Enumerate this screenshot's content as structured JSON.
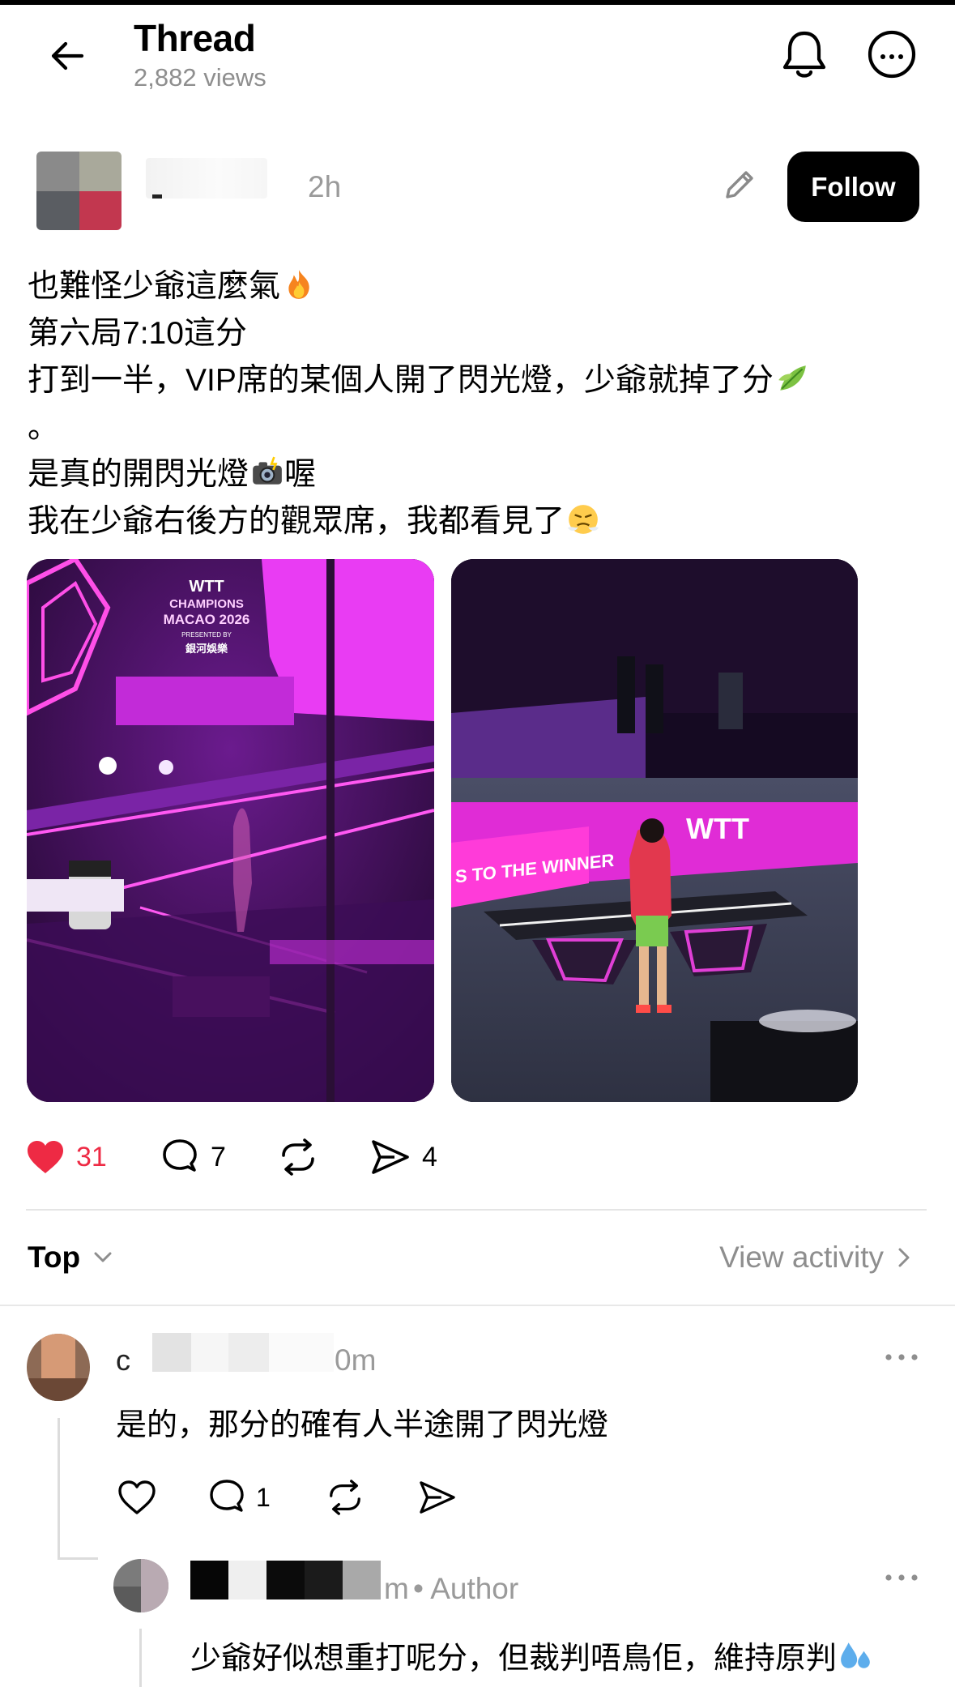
{
  "header": {
    "title": "Thread",
    "views": "2,882 views"
  },
  "post": {
    "time": "2h",
    "follow_label": "Follow",
    "lines": [
      "也難怪少爺這麼氣",
      "第六局7:10這分",
      "打到一半，VIP席的某個人開了閃光燈，少爺就掉了分",
      "。",
      "是真的開閃光燈",
      "喔",
      "我在少爺右後方的觀眾席，我都看見了"
    ],
    "photo1": {
      "sign_line1": "WTT",
      "sign_line2": "CHAMPIONS",
      "sign_line3": "MACAO 2026",
      "sign_line4": "PRESENTED BY",
      "sign_line5": "銀河娛樂"
    },
    "photo2": {
      "banner": "S TO THE WINNER",
      "brand": "WTT"
    },
    "actions": {
      "likes": "31",
      "comments": "7",
      "shares": "4"
    }
  },
  "sort": {
    "label": "Top",
    "view_activity": "View activity"
  },
  "comments": [
    {
      "name_initial": "c",
      "time": "0m",
      "text": "是的，那分的確有人半途開了閃光燈",
      "reply_count": "1"
    },
    {
      "time_fragment": "m",
      "author_tag": "• Author",
      "text": "少爺好似想重打呢分，但裁判唔鳥佢，維持原判"
    }
  ],
  "colors": {
    "like_red": "#ee2a44",
    "muted_gray": "#8e8e8e",
    "neon_magenta": "#e93cf3"
  }
}
